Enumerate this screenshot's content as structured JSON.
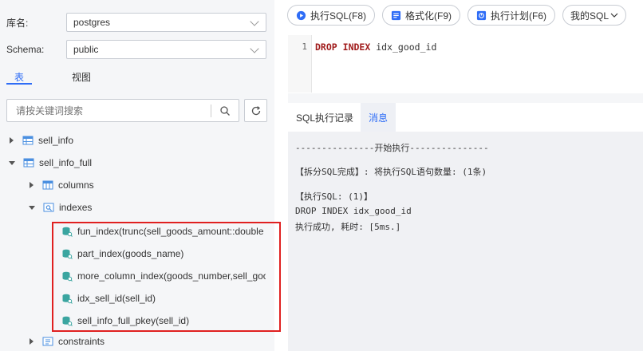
{
  "left": {
    "db_label": "库名:",
    "db_value": "postgres",
    "schema_label": "Schema:",
    "schema_value": "public",
    "tabs": [
      "表",
      "视图"
    ],
    "search_placeholder": "请按关键词搜索",
    "tree": {
      "sell_info": "sell_info",
      "sell_info_full": "sell_info_full",
      "columns": "columns",
      "indexes": "indexes",
      "index_items": [
        "fun_index(trunc(sell_goods_amount::double p",
        "part_index(goods_name)",
        "more_column_index(goods_number,sell_good",
        "idx_sell_id(sell_id)",
        "sell_info_full_pkey(sell_id)"
      ],
      "constraints": "constraints"
    }
  },
  "toolbar": {
    "run_label": "执行SQL(F8)",
    "format_label": "格式化(F9)",
    "plan_label": "执行计划(F6)",
    "my_sql_label": "我的SQL"
  },
  "editor": {
    "line_number": "1",
    "keyword_drop": "DROP",
    "keyword_index": "INDEX",
    "identifier": "idx_good_id"
  },
  "result_tabs": [
    "SQL执行记录",
    "消息"
  ],
  "console": {
    "lines": [
      "---------------开始执行---------------",
      "【拆分SQL完成】: 将执行SQL语句数量: (1条)",
      "【执行SQL: (1)】",
      "DROP INDEX idx_good_id",
      "执行成功, 耗时: [5ms.]"
    ]
  },
  "colors": {
    "accent": "#2f6df6",
    "highlight_border": "#e02020",
    "keyword": "#a01b1b"
  }
}
